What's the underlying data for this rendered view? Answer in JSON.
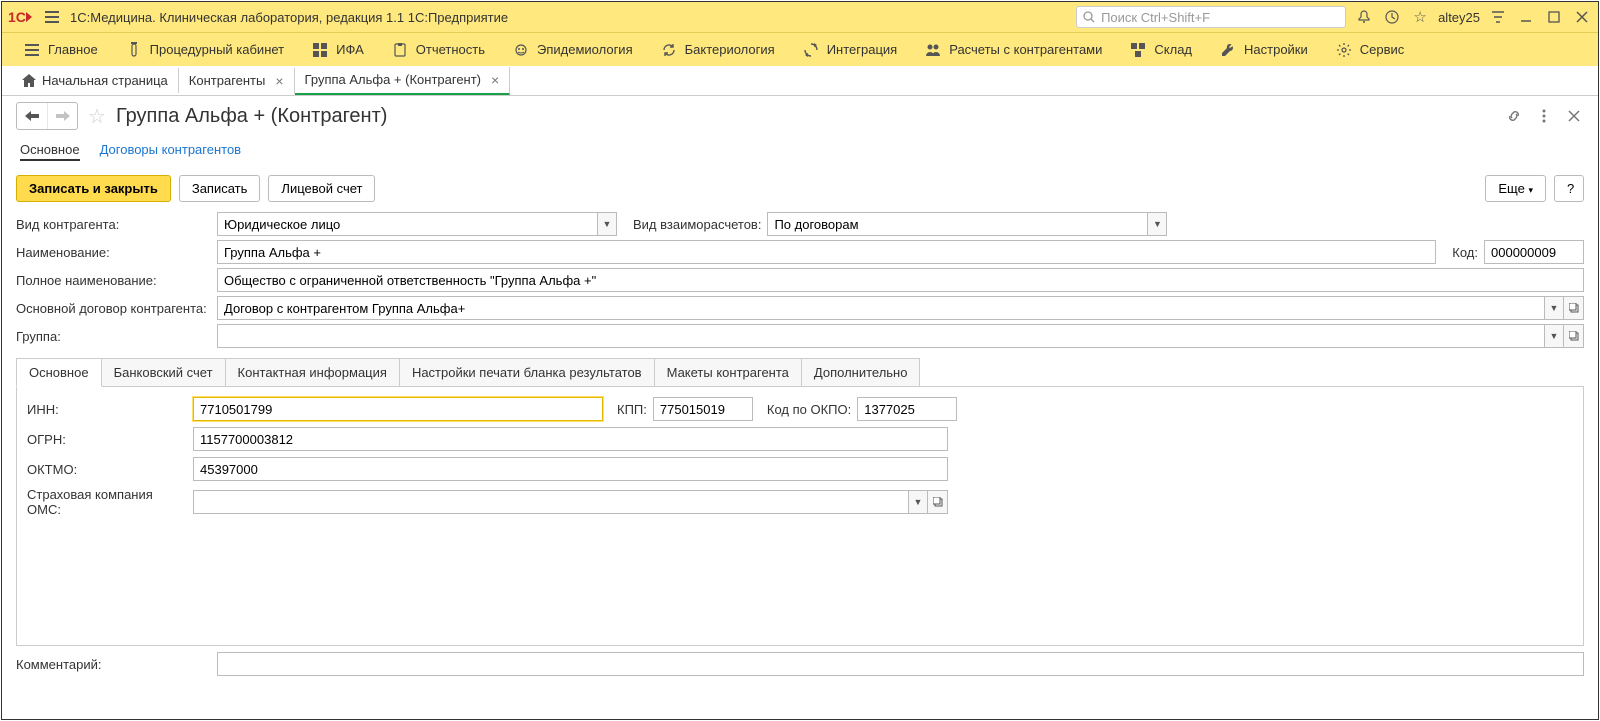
{
  "titlebar": {
    "app_title": "1С:Медицина. Клиническая лаборатория, редакция 1.1 1С:Предприятие",
    "search_placeholder": "Поиск Ctrl+Shift+F",
    "user": "altey25"
  },
  "menubar": [
    {
      "icon": "menu",
      "label": "Главное"
    },
    {
      "icon": "tube",
      "label": "Процедурный кабинет"
    },
    {
      "icon": "grid",
      "label": "ИФА"
    },
    {
      "icon": "doc",
      "label": "Отчетность"
    },
    {
      "icon": "virus",
      "label": "Эпидемиология"
    },
    {
      "icon": "refresh",
      "label": "Бактериология"
    },
    {
      "icon": "sync",
      "label": "Интеграция"
    },
    {
      "icon": "people",
      "label": "Расчеты с контрагентами"
    },
    {
      "icon": "boxes",
      "label": "Склад"
    },
    {
      "icon": "wrench",
      "label": "Настройки"
    },
    {
      "icon": "gear",
      "label": "Сервис"
    }
  ],
  "breadcrumbs": {
    "home": "Начальная страница",
    "tabs": [
      {
        "label": "Контрагенты",
        "active": false
      },
      {
        "label": "Группа Альфа + (Контрагент)",
        "active": true
      }
    ]
  },
  "page": {
    "title": "Группа Альфа + (Контрагент)"
  },
  "subnav": [
    {
      "label": "Основное",
      "active": true
    },
    {
      "label": "Договоры контрагентов",
      "link": true
    }
  ],
  "toolbar": {
    "save_close": "Записать и закрыть",
    "save": "Записать",
    "account": "Лицевой счет",
    "more": "Еще",
    "help": "?"
  },
  "form": {
    "kind_label": "Вид контрагента:",
    "kind_value": "Юридическое лицо",
    "settle_label": "Вид взаиморасчетов:",
    "settle_value": "По договорам",
    "name_label": "Наименование:",
    "name_value": "Группа Альфа +",
    "code_label": "Код:",
    "code_value": "000000009",
    "fullname_label": "Полное наименование:",
    "fullname_value": "Общество с ограниченной ответственность \"Группа Альфа +\"",
    "contract_label": "Основной договор контрагента:",
    "contract_value": "Договор с контрагентом Группа Альфа+",
    "group_label": "Группа:",
    "group_value": ""
  },
  "tabs": [
    "Основное",
    "Банковский счет",
    "Контактная информация",
    "Настройки печати бланка результатов",
    "Макеты контрагента",
    "Дополнительно"
  ],
  "tab_main": {
    "inn_label": "ИНН:",
    "inn_value": "7710501799",
    "kpp_label": "КПП:",
    "kpp_value": "775015019",
    "okpo_label": "Код по ОКПО:",
    "okpo_value": "1377025",
    "ogrn_label": "ОГРН:",
    "ogrn_value": "1157700003812",
    "oktmo_label": "ОКТМО:",
    "oktmo_value": "45397000",
    "insurance_label": "Страховая компания ОМС:",
    "insurance_value": ""
  },
  "comment": {
    "label": "Комментарий:",
    "value": ""
  }
}
